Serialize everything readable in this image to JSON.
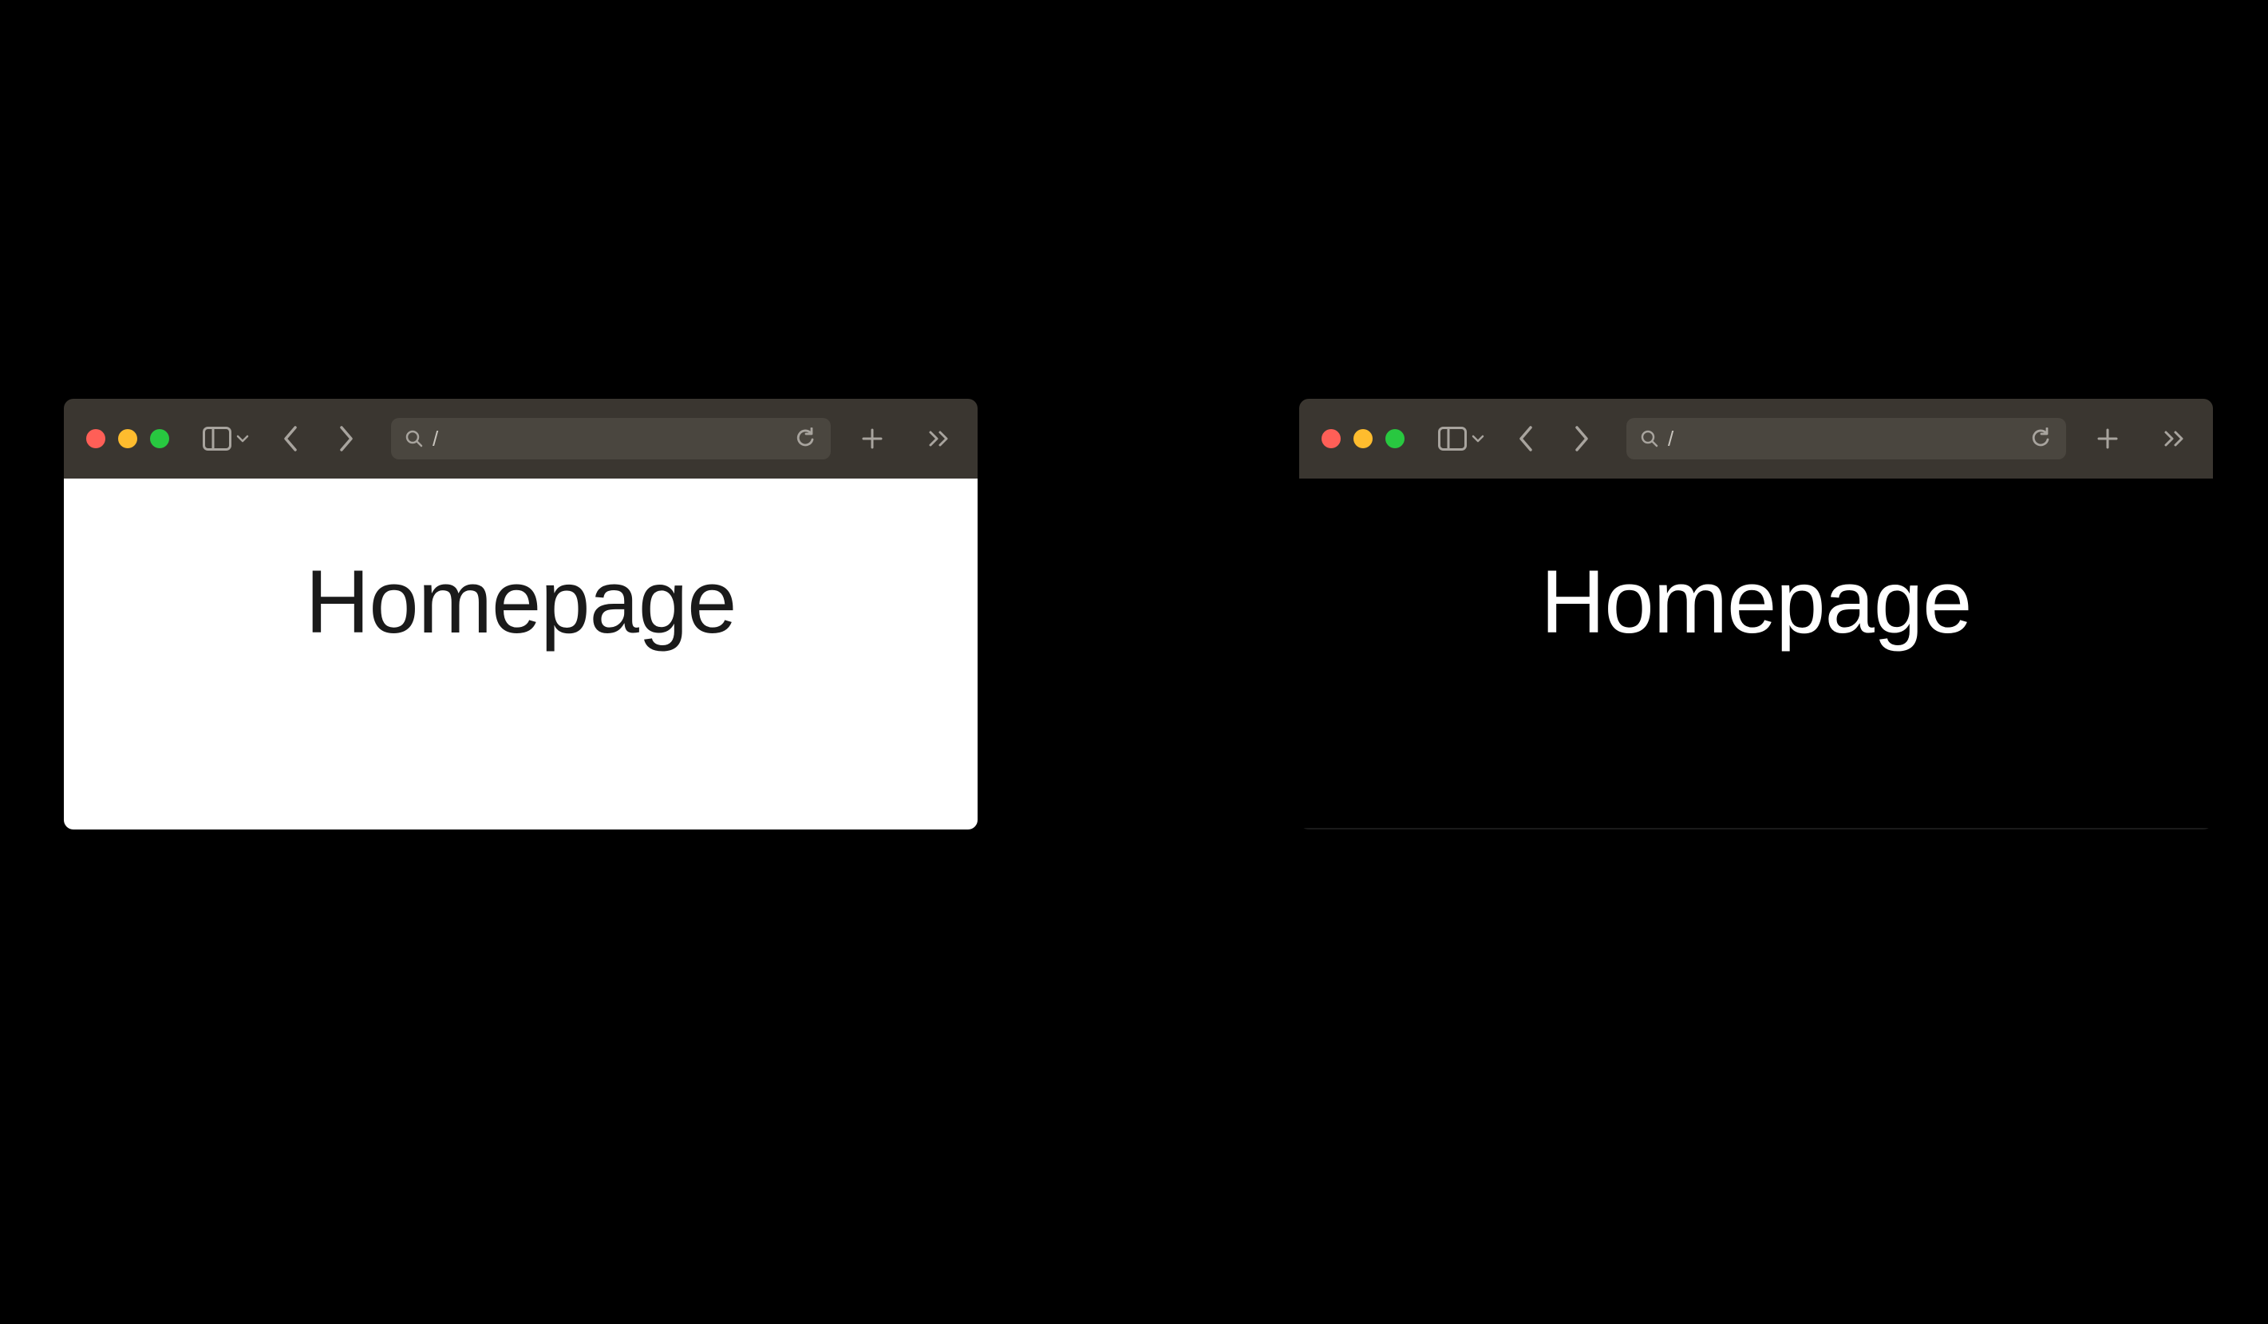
{
  "windows": {
    "light": {
      "mode": "light",
      "address": "/",
      "heading": "Homepage"
    },
    "dark": {
      "mode": "dark",
      "address": "/",
      "heading": "Homepage"
    }
  }
}
